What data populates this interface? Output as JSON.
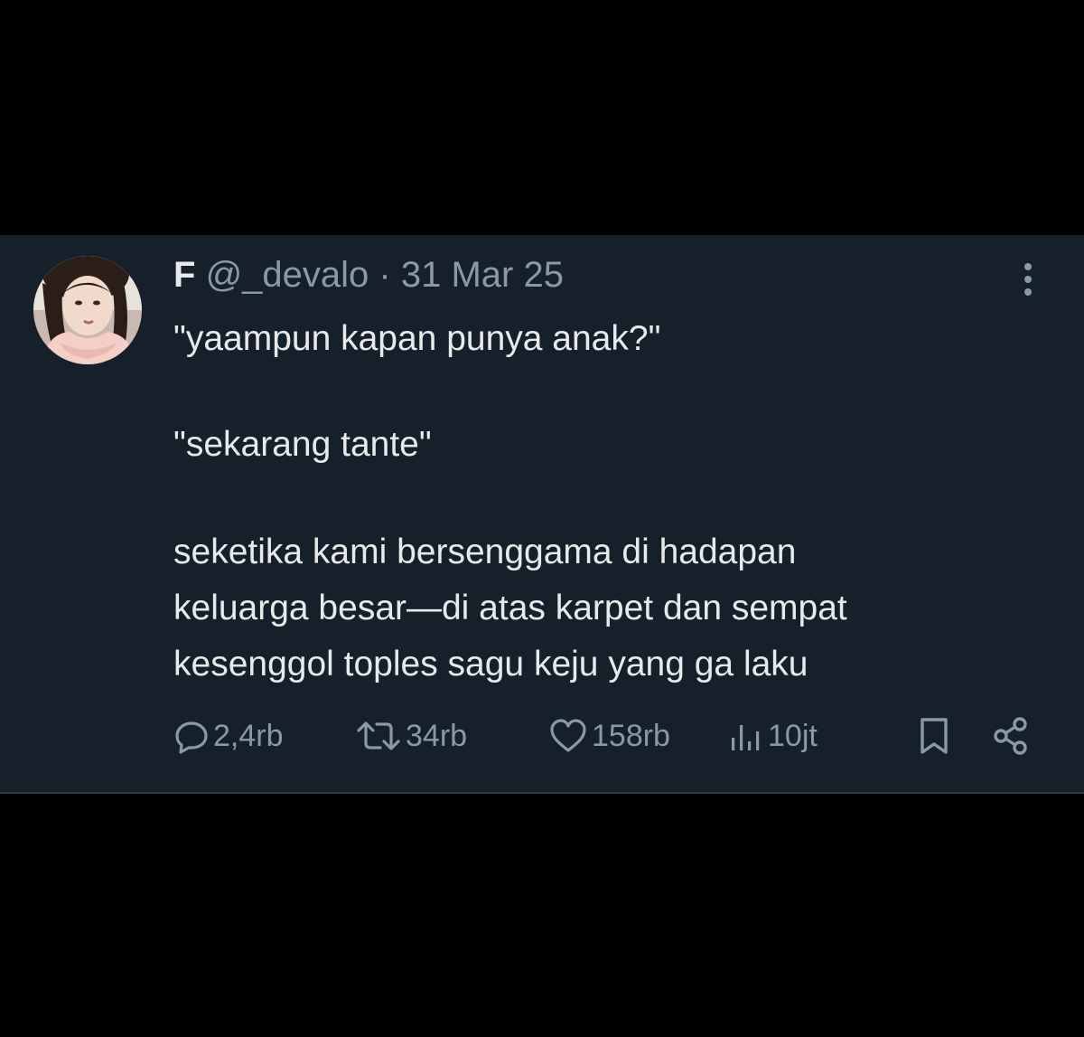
{
  "author": {
    "display_name": "F",
    "handle": "@_devalo",
    "separator": "·",
    "date": "31 Mar 25"
  },
  "icons": {
    "more": "more-vertical-icon",
    "reply": "reply-icon",
    "retweet": "retweet-icon",
    "like": "heart-icon",
    "views": "views-icon",
    "bookmark": "bookmark-icon",
    "share": "share-icon"
  },
  "tweet": {
    "lines": [
      "\"yaampun kapan punya anak?\"",
      "\"sekarang tante\"",
      "seketika kami bersenggama di hadapan",
      "keluarga besar—di atas karpet dan sempat",
      "kesenggol toples sagu keju yang ga laku"
    ]
  },
  "stats": {
    "replies": "2,4rb",
    "retweets": "34rb",
    "likes": "158rb",
    "views": "10jt"
  },
  "colors": {
    "page_background": "#000000",
    "card_background": "#15202b",
    "primary_text": "#e7e9ea",
    "secondary_text": "#8b98a5"
  }
}
